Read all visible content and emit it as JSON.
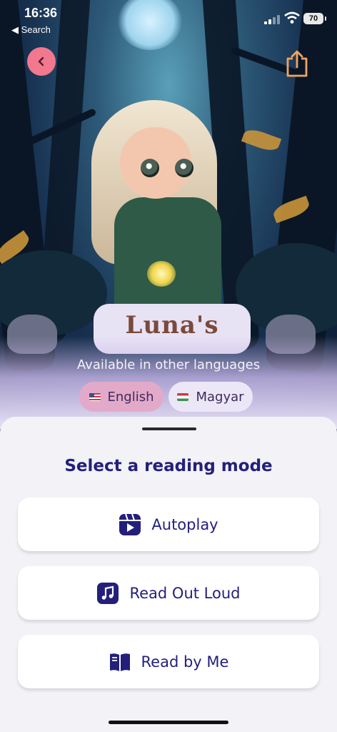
{
  "status_bar": {
    "time": "16:36",
    "back_app_label": "◀ Search",
    "battery": "70"
  },
  "book": {
    "title": "Luna's"
  },
  "languages": {
    "heading": "Available in other languages",
    "options": [
      {
        "label": "English",
        "selected": true
      },
      {
        "label": "Magyar",
        "selected": false
      }
    ]
  },
  "sheet": {
    "title": "Select a reading mode",
    "modes": [
      {
        "label": "Autoplay",
        "icon": "autoplay-icon"
      },
      {
        "label": "Read Out Loud",
        "icon": "music-note-icon"
      },
      {
        "label": "Read by Me",
        "icon": "book-icon"
      }
    ]
  },
  "colors": {
    "accent": "#231f7a",
    "back_button": "#f2788e",
    "share_icon": "#f0a464",
    "selected_chip": "#e3a9c9"
  }
}
